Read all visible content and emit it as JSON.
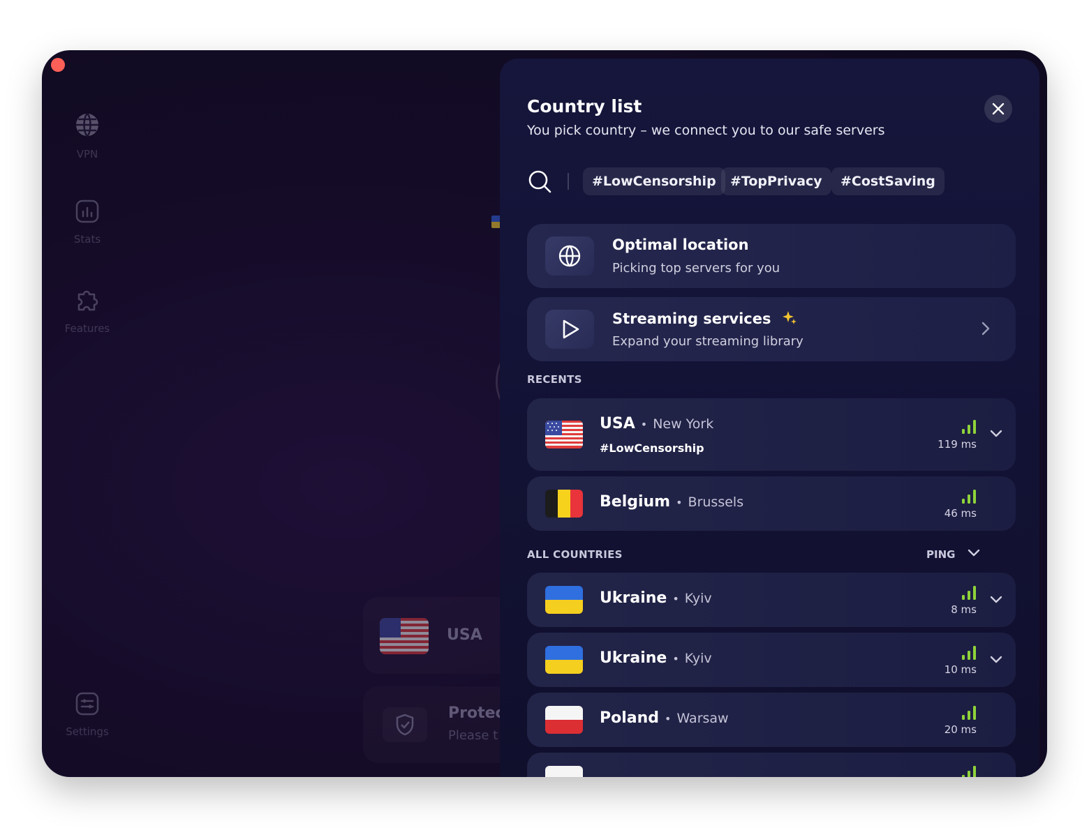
{
  "sidebar": {
    "items": [
      {
        "label": "VPN",
        "icon": "globe-icon"
      },
      {
        "label": "Stats",
        "icon": "stats-icon"
      },
      {
        "label": "Features",
        "icon": "puzzle-icon"
      },
      {
        "label": "Settings",
        "icon": "settings-icon"
      }
    ]
  },
  "background": {
    "current_country": "USA",
    "protect_title": "Protect",
    "protect_sub": "Please t"
  },
  "panel": {
    "title": "Country list",
    "subtitle": "You pick country – we connect you to our safe servers",
    "tags": [
      "#LowCensorship",
      "#TopPrivacy",
      "#CostSaving"
    ],
    "optimal": {
      "title": "Optimal location",
      "subtitle": "Picking top servers for you"
    },
    "streaming": {
      "title": "Streaming services",
      "subtitle": "Expand your streaming library"
    },
    "recents_label": "RECENTS",
    "all_label": "ALL COUNTRIES",
    "sort_label": "PING",
    "recents": [
      {
        "country": "USA",
        "city": "New York",
        "tag": "#LowCensorship",
        "ping": "119 ms",
        "flag": "us",
        "expandable": true
      },
      {
        "country": "Belgium",
        "city": "Brussels",
        "ping": "46 ms",
        "flag": "be",
        "expandable": false
      }
    ],
    "countries": [
      {
        "country": "Ukraine",
        "city": "Kyiv",
        "ping": "8 ms",
        "flag": "ua",
        "expandable": true
      },
      {
        "country": "Ukraine",
        "city": "Kyiv",
        "ping": "10 ms",
        "flag": "ua",
        "expandable": true
      },
      {
        "country": "Poland",
        "city": "Warsaw",
        "ping": "20 ms",
        "flag": "pl",
        "expandable": false
      }
    ]
  },
  "colors": {
    "signal": "#8fd33a",
    "sparkle": "#f4c430",
    "close_dot": "#fe5f57"
  }
}
